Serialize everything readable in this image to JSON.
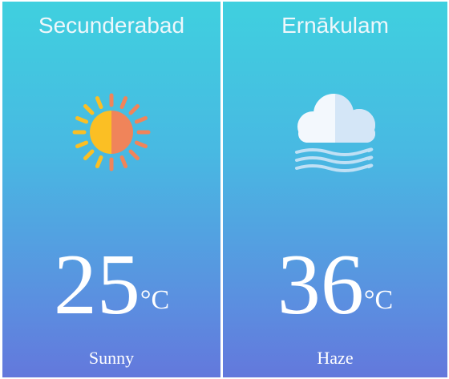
{
  "cards": [
    {
      "city": "Secunderabad",
      "icon": "sun-icon",
      "temperature": "25",
      "unit": "°C",
      "condition": "Sunny"
    },
    {
      "city": "Ernākulam",
      "icon": "haze-icon",
      "temperature": "36",
      "unit": "°C",
      "condition": "Haze"
    }
  ],
  "colors": {
    "gradient_top": "#3fd0df",
    "gradient_bottom": "#6378dc",
    "sun_left": "#fbbf24",
    "sun_right": "#f0845a",
    "cloud_light": "#f3f8fd",
    "cloud_shade": "#d4e6f7",
    "haze_lines": "#bfe0f5"
  }
}
